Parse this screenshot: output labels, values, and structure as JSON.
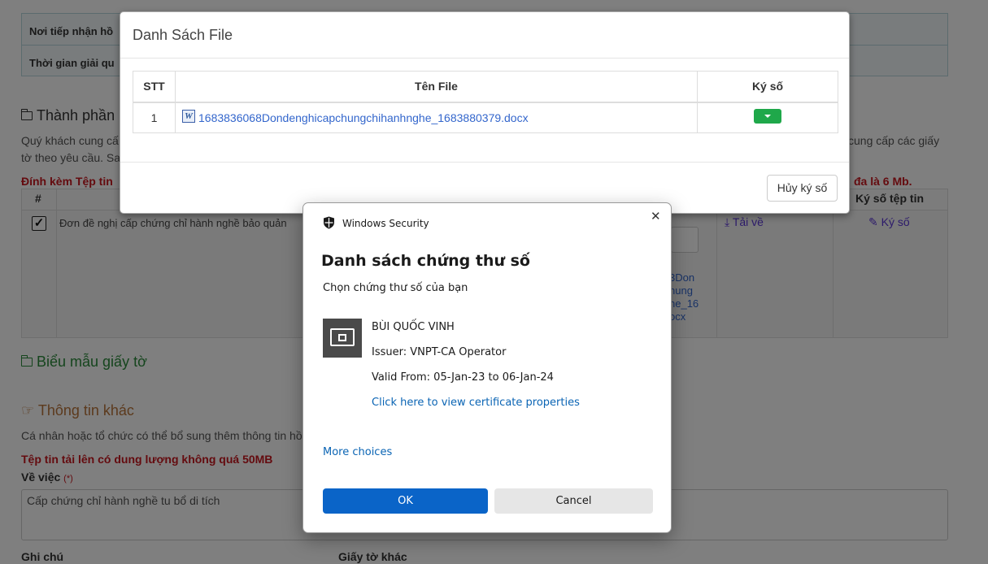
{
  "background": {
    "info_rows": [
      "Nơi tiếp nhận hồ",
      "Thời gian giải qu"
    ],
    "section_thanh_phan": "Thành phần",
    "para_line1_left": "Quý khách cung cấ",
    "para_line1_right": "cung cấp các giấy",
    "para_line2_left": "tờ theo yêu cầu. Sa",
    "attach_left": "Đính kèm Tệp tin",
    "attach_right": "đa là 6 Mb.",
    "col_hash": "#",
    "col_ky_so_tep_tin": "Ký số tệp tin",
    "row_doc_name": "Đơn đề nghị cấp chứng chỉ hành nghề bảo quản",
    "row_file_frag": [
      "3Don",
      "hung",
      "ne_16",
      "ocx"
    ],
    "tai_ve": "Tải về",
    "ky_so_link": "Ký số",
    "section_bieu_mau": "Biểu mẫu giấy tờ",
    "section_thong_tin": "Thông tin khác",
    "para_thong_tin": "Cá nhân hoặc tổ chức có thể bổ sung thêm thông tin hồ",
    "upload_limit": "Tệp tin tải lên có dung lượng không quá 50MB",
    "ve_viec_label": "Về việc",
    "required_mark": "(*)",
    "ve_viec_value": "Cấp chứng chỉ hành nghề tu bổ di tích",
    "ghi_chu_label": "Ghi chú",
    "giay_to_khac_label": "Giấy tờ khác"
  },
  "file_modal": {
    "title": "Danh Sách File",
    "headers": {
      "stt": "STT",
      "ten_file": "Tên File",
      "ky_so": "Ký số"
    },
    "rows": [
      {
        "stt": "1",
        "file_name": "1683836068Dondenghicapchungchihanhnghe_1683880379.docx"
      }
    ],
    "cancel_sign_label": "Hủy ký số",
    "word_icon_glyph": "W"
  },
  "security_dialog": {
    "app_name": "Windows Security",
    "title": "Danh sách chứng thư số",
    "subtitle": "Chọn chứng thư số của bạn",
    "certificate": {
      "holder": "BÙI QUỐC VINH",
      "issuer": "Issuer: VNPT-CA Operator",
      "valid": "Valid From: 05-Jan-23 to 06-Jan-24",
      "properties_link": "Click here to view certificate properties"
    },
    "more_choices": "More choices",
    "ok_label": "OK",
    "cancel_label": "Cancel",
    "close_glyph": "✕"
  },
  "colors": {
    "primary_button": "#0a64c8",
    "sign_button": "#1fa84a",
    "warning_text": "#c9171e",
    "link": "#3366cc"
  }
}
